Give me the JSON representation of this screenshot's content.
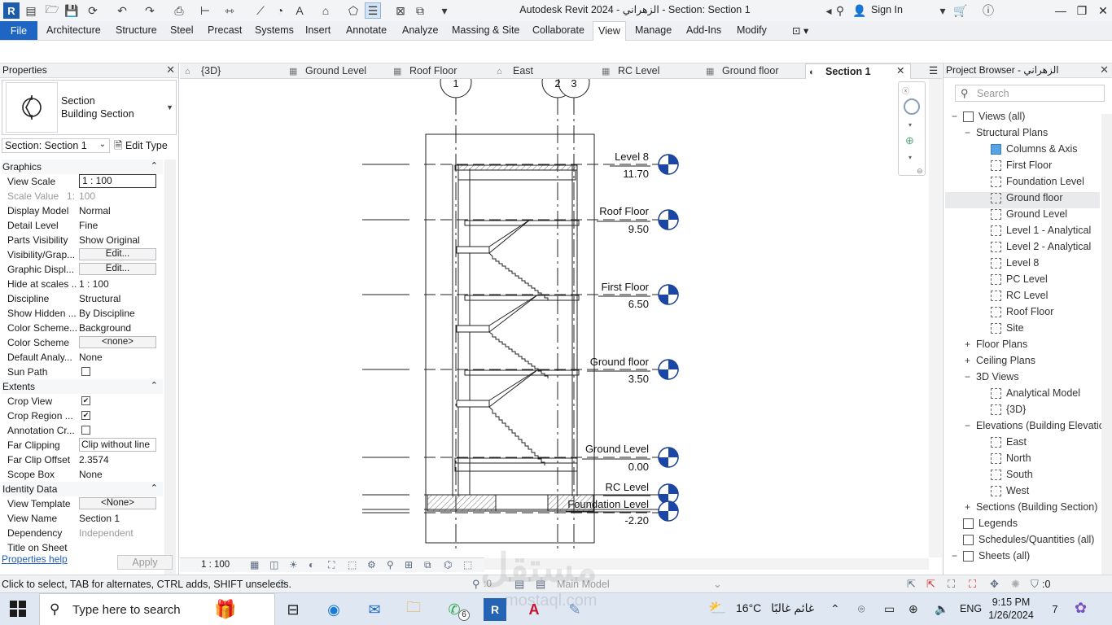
{
  "titlebar": {
    "title": "Autodesk Revit 2024 - الزهراني - Section: Section 1",
    "signin": "Sign In",
    "app_logo": "R"
  },
  "ribbon": {
    "file": "File",
    "tabs": [
      "Architecture",
      "Structure",
      "Steel",
      "Precast",
      "Systems",
      "Insert",
      "Annotate",
      "Analyze",
      "Massing & Site",
      "Collaborate",
      "View",
      "Manage",
      "Add-Ins",
      "Modify"
    ],
    "active_tab": "View"
  },
  "properties": {
    "header": "Properties",
    "type_family": "Section",
    "type_name": "Building Section",
    "instance": "Section: Section 1",
    "edit_type": "Edit Type",
    "groups": [
      {
        "label": "Graphics",
        "rows": [
          {
            "label": "View Scale",
            "value": "1 : 100",
            "kind": "input"
          },
          {
            "label": "Scale Value",
            "label2": "1:",
            "value": "100",
            "kind": "disabled"
          },
          {
            "label": "Display Model",
            "value": "Normal",
            "kind": "text"
          },
          {
            "label": "Detail Level",
            "value": "Fine",
            "kind": "text"
          },
          {
            "label": "Parts Visibility",
            "value": "Show Original",
            "kind": "text"
          },
          {
            "label": "Visibility/Grap...",
            "value": "Edit...",
            "kind": "button"
          },
          {
            "label": "Graphic Displ...",
            "value": "Edit...",
            "kind": "button"
          },
          {
            "label": "Hide at scales ...",
            "value": "1 : 100",
            "kind": "text"
          },
          {
            "label": "Discipline",
            "value": "Structural",
            "kind": "text"
          },
          {
            "label": "Show Hidden ...",
            "value": "By Discipline",
            "kind": "text"
          },
          {
            "label": "Color Scheme...",
            "value": "Background",
            "kind": "text"
          },
          {
            "label": "Color Scheme",
            "value": "<none>",
            "kind": "button"
          },
          {
            "label": "Default Analy...",
            "value": "None",
            "kind": "text"
          },
          {
            "label": "Sun Path",
            "value": "",
            "kind": "checkbox",
            "checked": false
          }
        ]
      },
      {
        "label": "Extents",
        "rows": [
          {
            "label": "Crop View",
            "value": "",
            "kind": "checkbox",
            "checked": true
          },
          {
            "label": "Crop Region ...",
            "value": "",
            "kind": "checkbox",
            "checked": true
          },
          {
            "label": "Annotation Cr...",
            "value": "",
            "kind": "checkbox",
            "checked": false
          },
          {
            "label": "Far Clipping",
            "value": "Clip without line",
            "kind": "box"
          },
          {
            "label": "Far Clip Offset",
            "value": "2.3574",
            "kind": "text"
          },
          {
            "label": "Scope Box",
            "value": "None",
            "kind": "text"
          }
        ]
      },
      {
        "label": "Identity Data",
        "rows": [
          {
            "label": "View Template",
            "value": "<None>",
            "kind": "button"
          },
          {
            "label": "View Name",
            "value": "Section 1",
            "kind": "text"
          },
          {
            "label": "Dependency",
            "value": "Independent",
            "kind": "disabled"
          },
          {
            "label": "Title on Sheet",
            "value": "",
            "kind": "text"
          }
        ]
      }
    ],
    "help": "Properties help",
    "apply": "Apply"
  },
  "view_tabs": [
    {
      "label": "{3D}",
      "icon": "house-icon",
      "active": false
    },
    {
      "label": "Ground Level",
      "icon": "plan-view-icon",
      "active": false
    },
    {
      "label": "Roof Floor",
      "icon": "plan-view-icon",
      "active": false
    },
    {
      "label": "East",
      "icon": "elevation-icon",
      "active": false
    },
    {
      "label": "RC Level",
      "icon": "plan-view-icon",
      "active": false
    },
    {
      "label": "Ground floor",
      "icon": "plan-view-icon",
      "active": false
    },
    {
      "label": "Section 1",
      "icon": "section-icon",
      "active": true
    }
  ],
  "section_view": {
    "grid_bubbles": [
      "1",
      "2",
      "3"
    ],
    "levels": [
      {
        "name": "Level 8",
        "elevation": "11.70"
      },
      {
        "name": "Roof Floor",
        "elevation": "9.50"
      },
      {
        "name": "First Floor",
        "elevation": "6.50"
      },
      {
        "name": "Ground floor",
        "elevation": "3.50"
      },
      {
        "name": "Ground Level",
        "elevation": "0.00"
      },
      {
        "name": "RC Level",
        "elevation": ""
      },
      {
        "name": "Foundation Level",
        "elevation": "-2.20"
      }
    ]
  },
  "view_control": {
    "scale": "1 : 100"
  },
  "browser": {
    "header": "Project Browser - الزهراني",
    "search_placeholder": "Search",
    "tree": [
      {
        "label": "Views (all)",
        "level": 0,
        "expander": "−",
        "icon": "views-icon"
      },
      {
        "label": "Structural Plans",
        "level": 1,
        "expander": "−"
      },
      {
        "label": "Columns & Axis",
        "level": 2,
        "icon": "view",
        "selected": true
      },
      {
        "label": "First Floor",
        "level": 2,
        "icon": "view"
      },
      {
        "label": "Foundation Level",
        "level": 2,
        "icon": "view"
      },
      {
        "label": "Ground floor",
        "level": 2,
        "icon": "view",
        "highlight": true
      },
      {
        "label": "Ground Level",
        "level": 2,
        "icon": "view"
      },
      {
        "label": "Level 1 - Analytical",
        "level": 2,
        "icon": "view"
      },
      {
        "label": "Level 2 - Analytical",
        "level": 2,
        "icon": "view"
      },
      {
        "label": "Level 8",
        "level": 2,
        "icon": "view"
      },
      {
        "label": "PC Level",
        "level": 2,
        "icon": "view"
      },
      {
        "label": "RC Level",
        "level": 2,
        "icon": "view"
      },
      {
        "label": "Roof Floor",
        "level": 2,
        "icon": "view"
      },
      {
        "label": "Site",
        "level": 2,
        "icon": "view"
      },
      {
        "label": "Floor Plans",
        "level": 1,
        "expander": "+"
      },
      {
        "label": "Ceiling Plans",
        "level": 1,
        "expander": "+"
      },
      {
        "label": "3D Views",
        "level": 1,
        "expander": "−"
      },
      {
        "label": "Analytical Model",
        "level": 2,
        "icon": "view"
      },
      {
        "label": "{3D}",
        "level": 2,
        "icon": "view"
      },
      {
        "label": "Elevations (Building Elevation)",
        "level": 1,
        "expander": "−"
      },
      {
        "label": "East",
        "level": 2,
        "icon": "view"
      },
      {
        "label": "North",
        "level": 2,
        "icon": "view"
      },
      {
        "label": "South",
        "level": 2,
        "icon": "view"
      },
      {
        "label": "West",
        "level": 2,
        "icon": "view"
      },
      {
        "label": "Sections (Building Section)",
        "level": 1,
        "expander": "+"
      },
      {
        "label": "Legends",
        "level": 0,
        "icon": "legend-icon"
      },
      {
        "label": "Schedules/Quantities (all)",
        "level": 0,
        "icon": "schedule-icon"
      },
      {
        "label": "Sheets (all)",
        "level": 0,
        "expander": "−",
        "icon": "sheet-icon"
      }
    ]
  },
  "status": {
    "text": "Click to select, TAB for alternates, CTRL adds, SHIFT unselects.",
    "worksets": ":0",
    "model": "Main Model",
    "filter": ":0"
  },
  "taskbar": {
    "search": "Type here to search",
    "weather_temp": "16°C",
    "weather_text": "غائم غالبًا",
    "lang": "ENG",
    "time": "9:15 PM",
    "date": "1/26/2024",
    "notifications": "7",
    "whatsapp_badge": "6"
  },
  "watermark": {
    "text": "مستقل",
    "sub": "mostaql.com"
  }
}
